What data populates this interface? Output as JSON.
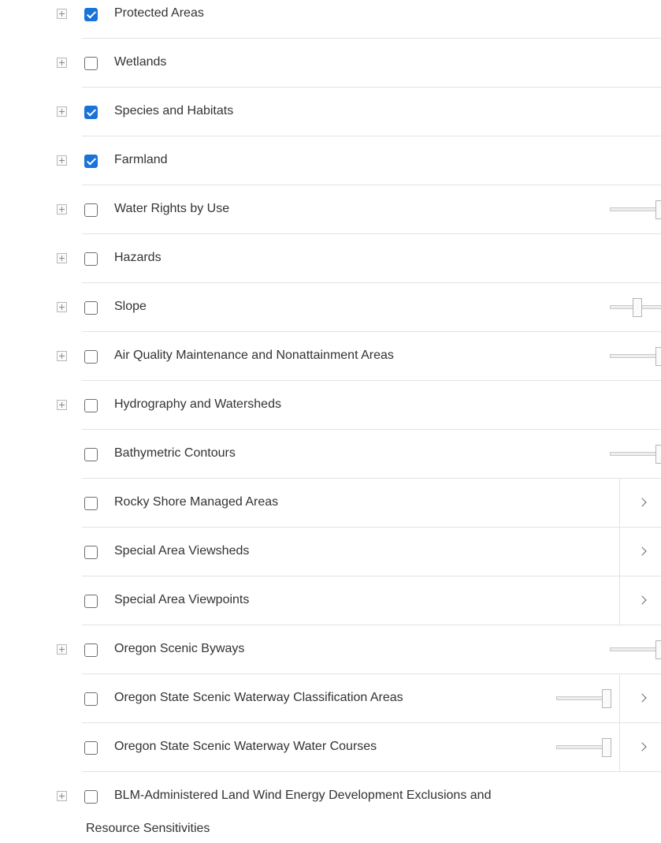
{
  "layers": [
    {
      "label": "Protected Areas",
      "checked": true,
      "expandable": true,
      "slider": null,
      "chevron": false
    },
    {
      "label": "Wetlands",
      "checked": false,
      "expandable": true,
      "slider": null,
      "chevron": false
    },
    {
      "label": "Species and Habitats",
      "checked": true,
      "expandable": true,
      "slider": null,
      "chevron": false
    },
    {
      "label": "Farmland",
      "checked": true,
      "expandable": true,
      "slider": null,
      "chevron": false
    },
    {
      "label": "Water Rights by Use",
      "checked": false,
      "expandable": true,
      "slider": {
        "value": 1.0
      },
      "chevron": false
    },
    {
      "label": "Hazards",
      "checked": false,
      "expandable": true,
      "slider": null,
      "chevron": false
    },
    {
      "label": "Slope",
      "checked": false,
      "expandable": true,
      "slider": {
        "value": 0.5
      },
      "chevron": false
    },
    {
      "label": "Air Quality Maintenance and Nonattainment Areas",
      "checked": false,
      "expandable": true,
      "slider": {
        "value": 1.0
      },
      "chevron": false
    },
    {
      "label": "Hydrography and Watersheds",
      "checked": false,
      "expandable": true,
      "slider": null,
      "chevron": false
    },
    {
      "label": "Bathymetric Contours",
      "checked": false,
      "expandable": false,
      "slider": {
        "value": 1.0
      },
      "chevron": false
    },
    {
      "label": "Rocky Shore Managed Areas",
      "checked": false,
      "expandable": false,
      "slider": null,
      "chevron": true
    },
    {
      "label": "Special Area Viewsheds",
      "checked": false,
      "expandable": false,
      "slider": null,
      "chevron": true
    },
    {
      "label": "Special Area Viewpoints",
      "checked": false,
      "expandable": false,
      "slider": null,
      "chevron": true
    },
    {
      "label": "Oregon Scenic Byways",
      "checked": false,
      "expandable": true,
      "slider": {
        "value": 1.0
      },
      "chevron": false
    },
    {
      "label": "Oregon State Scenic Waterway Classification Areas",
      "checked": false,
      "expandable": false,
      "slider": {
        "value": 1.0
      },
      "chevron": true
    },
    {
      "label": "Oregon State Scenic Waterway Water Courses",
      "checked": false,
      "expandable": false,
      "slider": {
        "value": 1.0
      },
      "chevron": true
    }
  ],
  "last_layer": {
    "label_line1": "BLM-Administered Land Wind Energy Development Exclusions and",
    "label_line2": "Resource Sensitivities",
    "checked": false,
    "expandable": true
  },
  "colors": {
    "checkbox_checked": "#1a73d9",
    "text": "#333333",
    "divider": "#e3e3e3"
  },
  "icons": {
    "expand": "plus-square-icon",
    "chevron": "chevron-right-icon"
  }
}
